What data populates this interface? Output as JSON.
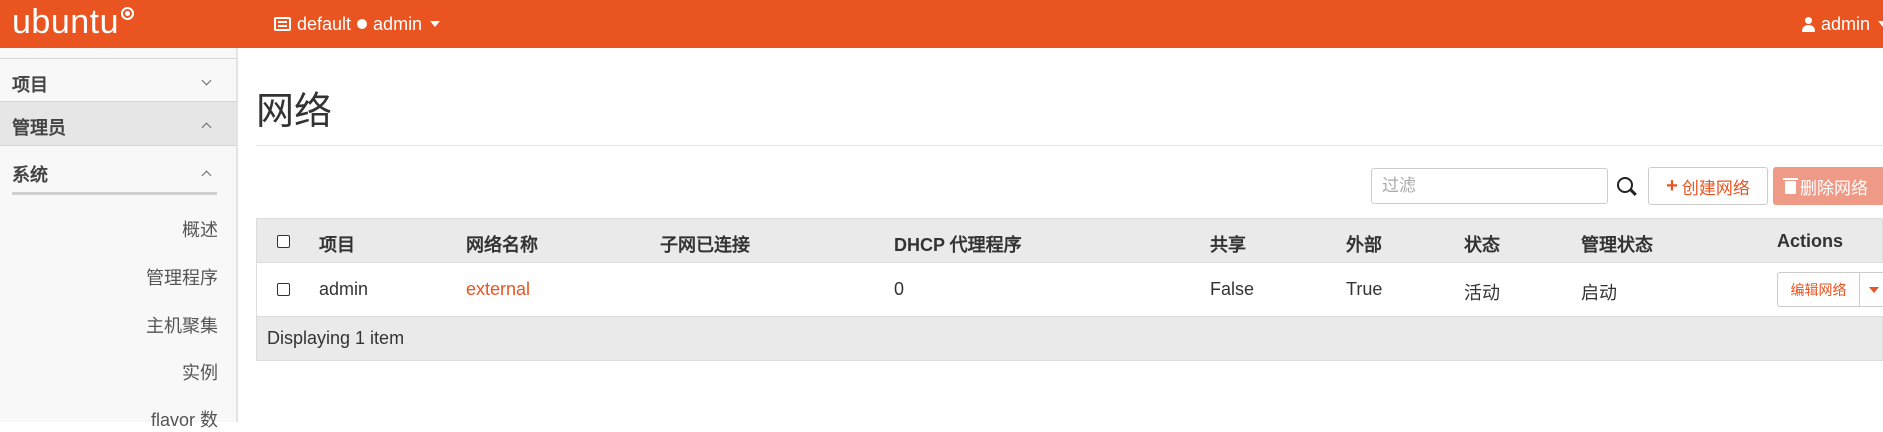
{
  "topbar": {
    "brand": "ubuntu",
    "project_switcher": {
      "domain": "default",
      "project": "admin"
    },
    "user": "admin",
    "accent_color": "#e95420"
  },
  "sidebar": {
    "sections": [
      {
        "label": "项目",
        "expanded": false
      },
      {
        "label": "管理员",
        "expanded": true
      },
      {
        "label": "系统",
        "expanded": true
      }
    ],
    "items": [
      "概述",
      "管理程序",
      "主机聚集",
      "实例",
      "flavor 数"
    ]
  },
  "main": {
    "title": "网络",
    "filter_placeholder": "过滤",
    "create_button": "创建网络",
    "delete_button": "删除网络",
    "table": {
      "headers": [
        "项目",
        "网络名称",
        "子网已连接",
        "DHCP 代理程序",
        "共享",
        "外部",
        "状态",
        "管理状态",
        "Actions"
      ],
      "rows": [
        {
          "project": "admin",
          "network_name": "external",
          "subnets": "",
          "dhcp_agents": "0",
          "shared": "False",
          "external": "True",
          "status": "活动",
          "admin_state": "启动",
          "action": "编辑网络"
        }
      ],
      "footer": "Displaying 1 item"
    }
  }
}
